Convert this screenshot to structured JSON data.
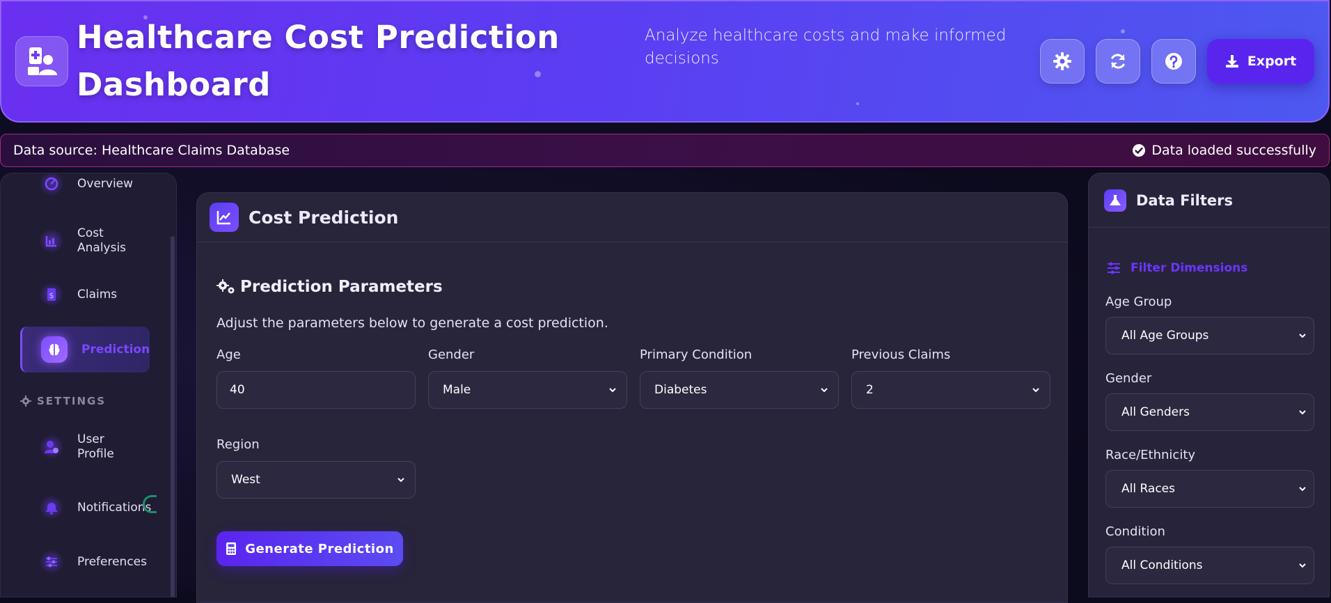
{
  "header": {
    "title": "Healthcare Cost Prediction Dashboard",
    "subtitle": "Analyze healthcare costs and make informed decisions",
    "export_label": "Export"
  },
  "status": {
    "source": "Data source: Healthcare Claims Database",
    "message": "Data loaded successfully"
  },
  "sidebar": {
    "items": [
      {
        "label": "Overview"
      },
      {
        "label": "Cost Analysis"
      },
      {
        "label": "Claims"
      },
      {
        "label": "Prediction"
      }
    ],
    "settings_label": "SETTINGS",
    "settings_items": [
      {
        "label": "User Profile"
      },
      {
        "label": "Notifications"
      },
      {
        "label": "Preferences"
      }
    ]
  },
  "main": {
    "title": "Cost Prediction",
    "section_title": "Prediction Parameters",
    "description": "Adjust the parameters below to generate a cost prediction.",
    "fields": {
      "age": {
        "label": "Age",
        "value": "40"
      },
      "gender": {
        "label": "Gender",
        "value": "Male"
      },
      "condition": {
        "label": "Primary Condition",
        "value": "Diabetes"
      },
      "claims": {
        "label": "Previous Claims",
        "value": "2"
      },
      "region": {
        "label": "Region",
        "value": "West"
      }
    },
    "generate_label": "Generate Prediction"
  },
  "filters": {
    "title": "Data Filters",
    "dimensions_label": "Filter Dimensions",
    "fields": [
      {
        "label": "Age Group",
        "value": "All Age Groups"
      },
      {
        "label": "Gender",
        "value": "All Genders"
      },
      {
        "label": "Race/Ethnicity",
        "value": "All Races"
      },
      {
        "label": "Condition",
        "value": "All Conditions"
      }
    ]
  },
  "colors": {
    "accent": "#5a24ef",
    "active_text": "#7a47ff",
    "status_border": "#a12a85"
  },
  "icons": {
    "logo": "hospital-user-icon",
    "settings": "gear-icon",
    "refresh": "refresh-icon",
    "help": "question-icon",
    "export": "download-icon",
    "status": "check-circle-icon"
  }
}
